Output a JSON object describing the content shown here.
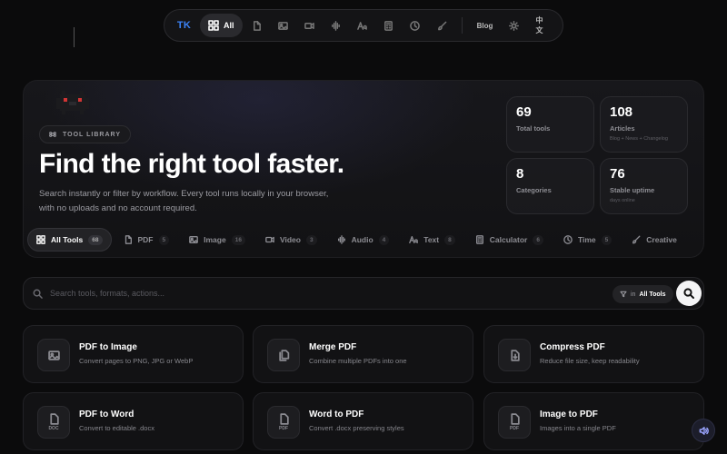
{
  "nav": {
    "logo": "TK",
    "all_label": "All",
    "icons": [
      "pdf-icon",
      "image-icon",
      "video-icon",
      "audio-icon",
      "text-icon",
      "calculator-icon",
      "clock-icon",
      "brush-icon"
    ],
    "blog": "Blog",
    "theme_icon": "sun-icon",
    "language": "中文"
  },
  "hero": {
    "badge": "TOOL LIBRARY",
    "title": "Find the right tool faster.",
    "subtitle_line1": "Search instantly or filter by workflow. Every tool runs locally in your browser,",
    "subtitle_line2": "with no uploads and no account required."
  },
  "stats": [
    {
      "value": "69",
      "label": "Total tools",
      "note": ""
    },
    {
      "value": "108",
      "label": "Articles",
      "note": "Blog + News + Changelog"
    },
    {
      "value": "8",
      "label": "Categories",
      "note": ""
    },
    {
      "value": "76",
      "label": "Stable uptime",
      "note": "days online"
    }
  ],
  "tabs": [
    {
      "label": "All Tools",
      "count": "68",
      "icon": "grid-icon"
    },
    {
      "label": "PDF",
      "count": "5",
      "icon": "pdf-icon"
    },
    {
      "label": "Image",
      "count": "16",
      "icon": "image-icon"
    },
    {
      "label": "Video",
      "count": "3",
      "icon": "video-icon"
    },
    {
      "label": "Audio",
      "count": "4",
      "icon": "audio-icon"
    },
    {
      "label": "Text",
      "count": "8",
      "icon": "text-icon"
    },
    {
      "label": "Calculator",
      "count": "6",
      "icon": "calculator-icon"
    },
    {
      "label": "Time",
      "count": "5",
      "icon": "clock-icon"
    },
    {
      "label": "Creative",
      "count": "",
      "icon": "brush-icon"
    }
  ],
  "search": {
    "placeholder": "Search tools, formats, actions...",
    "scope_prefix": "in",
    "scope_value": "All Tools"
  },
  "tools": [
    {
      "title": "PDF to Image",
      "desc": "Convert pages to PNG, JPG or WebP",
      "icon": "image-icon",
      "tag": ""
    },
    {
      "title": "Merge PDF",
      "desc": "Combine multiple PDFs into one",
      "icon": "files-icon",
      "tag": ""
    },
    {
      "title": "Compress PDF",
      "desc": "Reduce file size, keep readability",
      "icon": "compress-icon",
      "tag": ""
    },
    {
      "title": "PDF to Word",
      "desc": "Convert to editable .docx",
      "icon": "doc-icon",
      "tag": "DOC"
    },
    {
      "title": "Word to PDF",
      "desc": "Convert .docx preserving styles",
      "icon": "pdf-file-icon",
      "tag": "PDF"
    },
    {
      "title": "Image to PDF",
      "desc": "Images into a single PDF",
      "icon": "pdf-file-icon",
      "tag": "PDF"
    }
  ],
  "colors": {
    "background": "#0b0b0c",
    "accent": "#3b82f6",
    "card": "#121214",
    "text": "#ffffff",
    "muted": "#86868c"
  }
}
